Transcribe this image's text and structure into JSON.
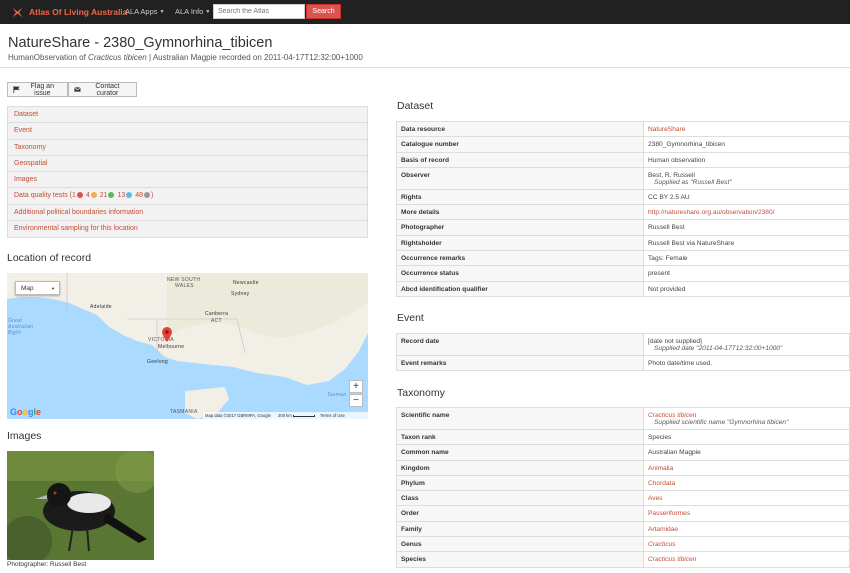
{
  "navbar": {
    "brand": "Atlas Of Living Australia",
    "menu_apps": "ALA Apps",
    "menu_info": "ALA Info",
    "search_placeholder": "Search the Atlas",
    "search_button": "Search",
    "brand_color": "#f26649"
  },
  "header": {
    "title": "NatureShare - 2380_Gymnorhina_tibicen",
    "subtitle_prefix": "HumanObservation of ",
    "subtitle_species": "Cracticus tibicen",
    "subtitle_suffix": " | Australian Magpie recorded on 2011-04-17T12:32:00+1000"
  },
  "actions": {
    "flag_issue": "Flag an issue",
    "contact_curator": "Contact curator"
  },
  "side_nav": {
    "items": [
      "Dataset",
      "Event",
      "Taxonomy",
      "Geospatial",
      "Images"
    ],
    "dq_label": "Data quality tests (",
    "dq_counts": [
      "1",
      "4",
      "21",
      "13",
      "48"
    ],
    "dq_close": ")",
    "dq_colors": [
      "#d9534f",
      "#f0ad4e",
      "#5cb85c",
      "#5bc0de",
      "#999999"
    ],
    "extra_items": [
      "Additional political boundaries information",
      "Environmental sampling for this location"
    ]
  },
  "location": {
    "heading": "Location of record",
    "map_type": "Map",
    "zoom_in": "+",
    "zoom_out": "−",
    "labels": {
      "nsw": "NEW SOUTH",
      "wales": "WALES",
      "newcastle": "Newcastle",
      "sydney": "Sydney",
      "adelaide": "Adelaide",
      "canberra": "Canberra",
      "act": "ACT",
      "victoria": "VICTORIA",
      "melbourne": "Melbourne",
      "geelong": "Geelong",
      "tasmania": "TASMANIA",
      "bight": "Great Australian Bight",
      "tasman": "Tasman"
    },
    "google": "Google",
    "attribution": "Map data ©2017 GBRMPA, Google",
    "scale": "200 km",
    "terms": "Terms of Use"
  },
  "images": {
    "heading": "Images",
    "caption": "Photographer: Russell Best"
  },
  "dataset": {
    "heading": "Dataset",
    "rows": [
      {
        "label": "Data resource",
        "value": "NatureShare",
        "link": true
      },
      {
        "label": "Catalogue number",
        "value": "2380_Gymnorhina_tibicen"
      },
      {
        "label": "Basis of record",
        "value": "Human observation"
      },
      {
        "label": "Observer",
        "value": "Best, R. Russell",
        "sub": "Supplied as \"Russell Best\""
      },
      {
        "label": "Rights",
        "value": "CC BY 2.5 AU"
      },
      {
        "label": "More details",
        "value": "http://natureshare.org.au/observation/2380/",
        "link": true
      },
      {
        "label": "Photographer",
        "value": "Russell Best"
      },
      {
        "label": "Rightsholder",
        "value": "Russell Best via NatureShare"
      },
      {
        "label": "Occurrence remarks",
        "value": "Tags: Female"
      },
      {
        "label": "Occurrence status",
        "value": "present"
      },
      {
        "label": "Abcd identification qualifier",
        "value": "Not provided"
      }
    ]
  },
  "event": {
    "heading": "Event",
    "rows": [
      {
        "label": "Record date",
        "value": "[date not supplied]",
        "sub": "Supplied date \"2011-04-17T12:32:00+1000\""
      },
      {
        "label": "Event remarks",
        "value": "Photo date/time used."
      }
    ]
  },
  "taxonomy": {
    "heading": "Taxonomy",
    "rows": [
      {
        "label": "Scientific name",
        "value": "Cracticus tibicen",
        "link": true,
        "italic": true,
        "sub": "Supplied scientific name \"Gymnorhina tibicen\""
      },
      {
        "label": "Taxon rank",
        "value": "Species"
      },
      {
        "label": "Common name",
        "value": "Australian Magpie"
      },
      {
        "label": "Kingdom",
        "value": "Animalia",
        "link": true
      },
      {
        "label": "Phylum",
        "value": "Chordata",
        "link": true
      },
      {
        "label": "Class",
        "value": "Aves",
        "link": true
      },
      {
        "label": "Order",
        "value": "Passeriformes",
        "link": true
      },
      {
        "label": "Family",
        "value": "Artamidae",
        "link": true
      },
      {
        "label": "Genus",
        "value": "Cracticus",
        "link": true,
        "italic": true
      },
      {
        "label": "Species",
        "value": "Cracticus tibicen",
        "link": true,
        "italic": true
      }
    ]
  }
}
